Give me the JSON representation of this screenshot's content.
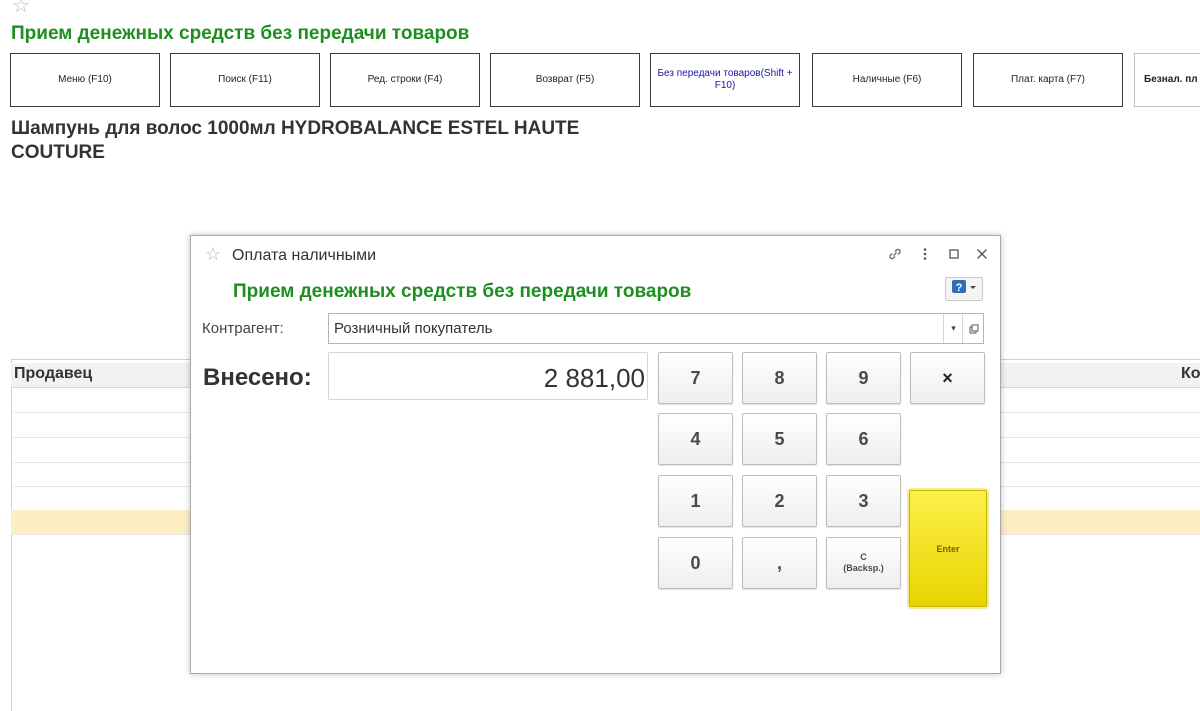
{
  "page": {
    "title": "Прием денежных средств без передачи товаров",
    "product_name": "Шампунь для волос 1000мл HYDROBALANCE ESTEL HAUTE COUTURE"
  },
  "toolbar": {
    "buttons": [
      "Меню (F10)",
      "Поиск (F11)",
      "Ред. строки (F4)",
      "Возврат (F5)",
      "Без передачи товаров(Shift + F10)",
      "Наличные (F6)",
      "Плат. карта (F7)",
      "Безнал. пл"
    ]
  },
  "table": {
    "columns": [
      "Продавец",
      "Ко"
    ]
  },
  "dialog": {
    "window_title": "Оплата наличными",
    "heading": "Прием денежных средств без передачи товаров",
    "counterparty_label": "Контрагент:",
    "counterparty_value": "Розничный покупатель",
    "paid_label": "Внесено:",
    "paid_amount": "2 881,00"
  },
  "keypad": {
    "k7": "7",
    "k8": "8",
    "k9": "9",
    "clear": "×",
    "k4": "4",
    "k5": "5",
    "k6": "6",
    "k1": "1",
    "k2": "2",
    "k3": "3",
    "k0": "0",
    "comma": ",",
    "backspace_line1": "С",
    "backspace_line2": "(Backsp.)",
    "enter": "Enter"
  },
  "colors": {
    "accent_green": "#1e8f1e",
    "enter_yellow": "#f0dc16",
    "selected_row": "#fdefc3"
  },
  "icons": [
    "star-icon",
    "link-icon",
    "more-icon",
    "maximize-icon",
    "close-icon",
    "help-icon",
    "dropdown-icon",
    "open-icon"
  ]
}
